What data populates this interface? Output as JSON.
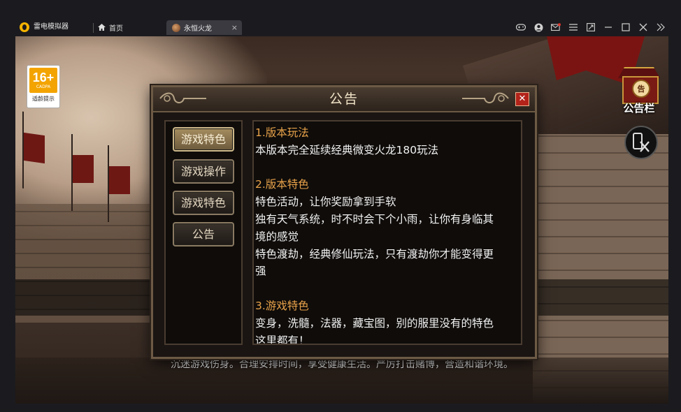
{
  "emulator": {
    "app_name": "雷电模拟器",
    "home_tab": "首页",
    "game_tab": "永恒火龙",
    "tab_close": "×"
  },
  "game": {
    "age_badge": {
      "rating": "16+",
      "org": "CADPA",
      "note": "适龄提示"
    },
    "notice_icon": {
      "label": "公告栏",
      "glyph": "告"
    },
    "health_notice": "沉迷游戏伤身。合理安排时间，享受健康生活。严厉打击赌博，营造和谐环境。"
  },
  "dialog": {
    "title": "公告",
    "close": "✕",
    "menu": [
      {
        "label": "游戏特色",
        "active": true
      },
      {
        "label": "游戏操作",
        "active": false
      },
      {
        "label": "游戏特色",
        "active": false
      },
      {
        "label": "公告",
        "active": false
      }
    ],
    "sections": [
      {
        "heading": "1.版本玩法",
        "lines": [
          "本版本完全延续经典微变火龙180玩法"
        ]
      },
      {
        "heading": "2.版本特色",
        "lines": [
          "特色活动，让你奖励拿到手软",
          "独有天气系统，时不时会下个小雨，让你有身临其",
          "境的感觉",
          "特色渡劫，经典修仙玩法，只有渡劫你才能变得更",
          "强"
        ]
      },
      {
        "heading": "3.游戏特色",
        "lines": [
          "变身，洗髓，法器，藏宝图，别的服里没有的特色",
          "这里都有！"
        ]
      }
    ]
  },
  "colors": {
    "section_heading": "#e9a34a",
    "active_menu": "#a68d60",
    "close_button": "#b3231a",
    "age_badge": "#f3a400"
  }
}
